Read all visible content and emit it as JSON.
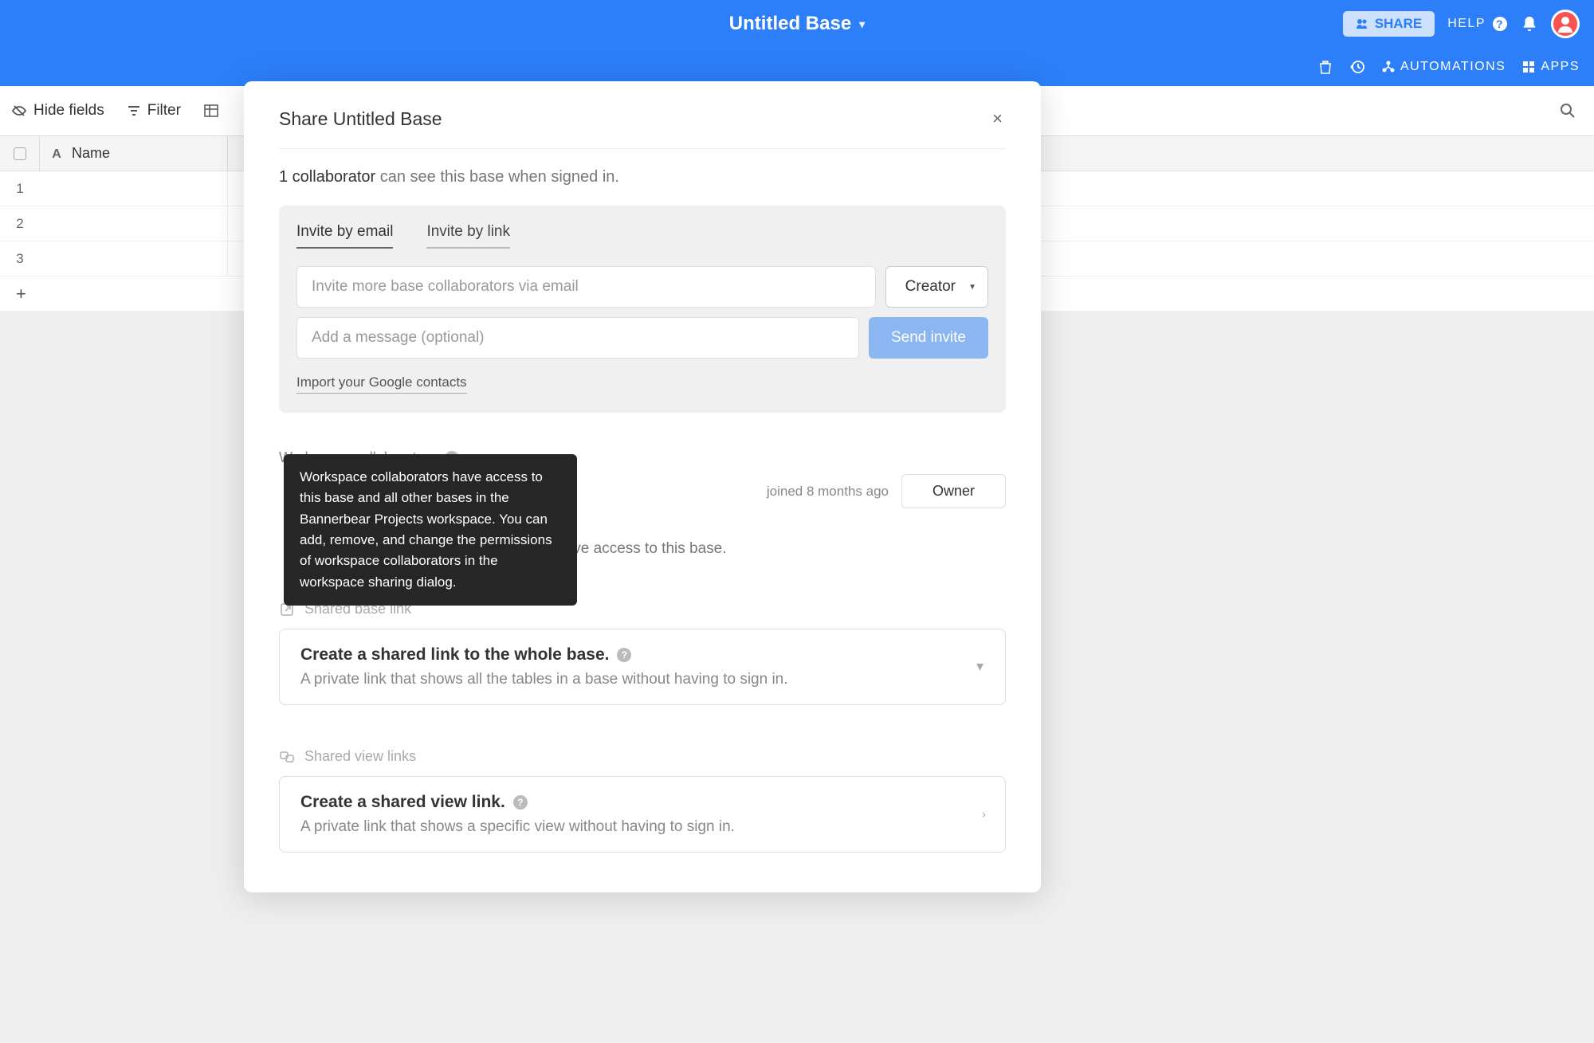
{
  "header": {
    "base_title": "Untitled Base",
    "share_label": "SHARE",
    "help_label": "HELP",
    "automations_label": "AUTOMATIONS",
    "apps_label": "APPS"
  },
  "toolbar": {
    "hide_fields": "Hide fields",
    "filter": "Filter"
  },
  "grid": {
    "name_header": "Name",
    "rows": [
      "1",
      "2",
      "3"
    ]
  },
  "modal": {
    "title": "Share Untitled Base",
    "subtitle_bold": "1 collaborator",
    "subtitle_rest": " can see this base when signed in.",
    "tabs": {
      "email": "Invite by email",
      "link": "Invite by link"
    },
    "email_placeholder": "Invite more base collaborators via email",
    "role": "Creator",
    "message_placeholder": "Add a message (optional)",
    "send_invite": "Send invite",
    "import_contacts": "Import your Google contacts",
    "workspace_collab_label": "Workspace collaborators",
    "joined": "joined 8 months ago",
    "owner": "Owner",
    "collab_desc": "tor (on other bases) that do not have access to this base.",
    "shared_base_label": "Shared base link",
    "shared_base_card_title": "Create a shared link to the whole base.",
    "shared_base_card_desc": "A private link that shows all the tables in a base without having to sign in.",
    "shared_view_label": "Shared view links",
    "shared_view_card_title": "Create a shared view link.",
    "shared_view_card_desc": "A private link that shows a specific view without having to sign in."
  },
  "tooltip": "Workspace collaborators have access to this base and all other bases in the Bannerbear Projects workspace. You can add, remove, and change the permissions of workspace collaborators in the workspace sharing dialog."
}
